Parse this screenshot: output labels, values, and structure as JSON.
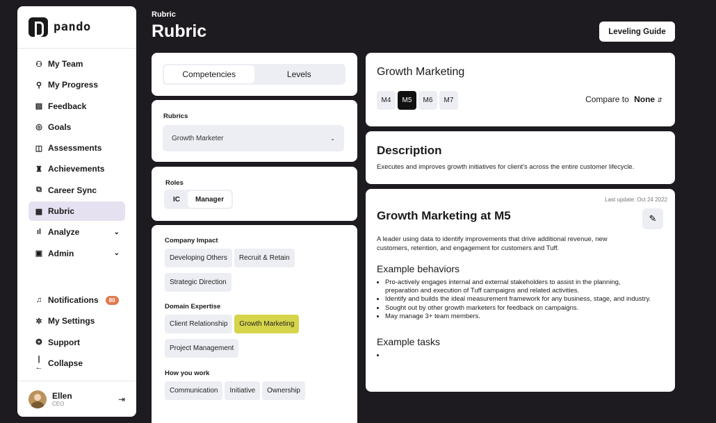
{
  "brand": {
    "name": "pando"
  },
  "nav": {
    "items": [
      {
        "label": "My Team",
        "icon": "people-icon",
        "glyph": "⚇"
      },
      {
        "label": "My Progress",
        "icon": "person-icon",
        "glyph": "⚲"
      },
      {
        "label": "Feedback",
        "icon": "message-icon",
        "glyph": "▤"
      },
      {
        "label": "Goals",
        "icon": "target-icon",
        "glyph": "◎"
      },
      {
        "label": "Assessments",
        "icon": "chart-icon",
        "glyph": "◫"
      },
      {
        "label": "Achievements",
        "icon": "trophy-icon",
        "glyph": "♜"
      },
      {
        "label": "Career Sync",
        "icon": "sync-icon",
        "glyph": "⧉"
      },
      {
        "label": "Rubric",
        "icon": "rubric-icon",
        "glyph": "▦"
      },
      {
        "label": "Analyze",
        "icon": "bar-chart-icon",
        "glyph": "ıl"
      },
      {
        "label": "Admin",
        "icon": "document-icon",
        "glyph": "▣"
      }
    ],
    "bottom": [
      {
        "label": "Notifications",
        "icon": "bell-icon",
        "glyph": "♫"
      },
      {
        "label": "My Settings",
        "icon": "gear-icon",
        "glyph": "✲"
      },
      {
        "label": "Support",
        "icon": "support-icon",
        "glyph": "❂"
      },
      {
        "label": "Collapse",
        "icon": "collapse-icon",
        "glyph": "|←"
      }
    ],
    "notification_count": "80"
  },
  "user": {
    "name": "Ellen",
    "role": "CEO"
  },
  "header": {
    "breadcrumb": "Rubric",
    "title": "Rubric",
    "leveling_guide": "Leveling Guide"
  },
  "tabs": {
    "competencies": "Competencies",
    "levels": "Levels"
  },
  "rubrics": {
    "label": "Rubrics",
    "selected": "Growth Marketer"
  },
  "roles": {
    "label": "Roles",
    "ic": "IC",
    "manager": "Manager"
  },
  "groups": [
    {
      "title": "Company Impact",
      "chips": [
        "Developing Others",
        "Recruit & Retain",
        "Strategic Direction"
      ]
    },
    {
      "title": "Domain Expertise",
      "chips": [
        "Client Relationship",
        "Growth Marketing",
        "Project Management"
      ]
    },
    {
      "title": "How you work",
      "chips": [
        "Communication",
        "Initiative",
        "Ownership"
      ]
    }
  ],
  "competency": {
    "title": "Growth Marketing",
    "levels": [
      "M4",
      "M5",
      "M6",
      "M7"
    ],
    "compare_label": "Compare to",
    "compare_value": "None",
    "description_title": "Description",
    "description": "Executes and improves growth initiatives for client's across the entire customer lifecycle.",
    "last_update": "Last update: Oct 24 2022",
    "level_title": "Growth Marketing at M5",
    "level_desc": "A leader using data to identify improvements that drive additional revenue, new customers, retention, and engagement for customers and Tuff.",
    "behaviors_title": "Example behaviors",
    "behaviors": [
      "Pro-actively engages internal and external stakeholders to assist in the planning, preparation and execution of Tuff campaigns and related activities.",
      "Identify and builds the ideal measurement framework for any business, stage, and industry.",
      "Sought out by other growth marketers for feedback on campaigns.",
      "May manage 3+ team members."
    ],
    "tasks_title": "Example tasks",
    "tasks": [
      ""
    ]
  }
}
